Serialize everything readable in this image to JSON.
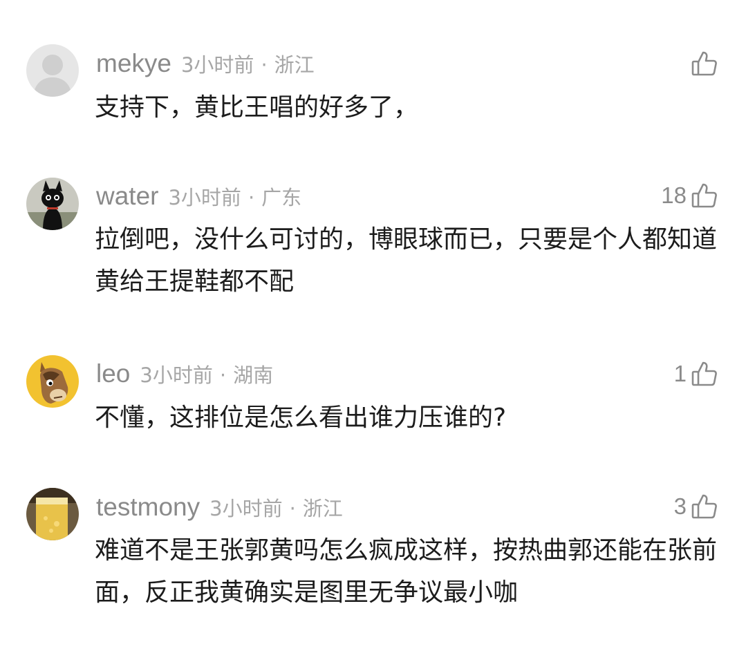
{
  "comments": [
    {
      "username": "mekye",
      "time": "3小时前",
      "separator": "·",
      "location": "浙江",
      "like_count": "",
      "text": "支持下，黄比王唱的好多了，"
    },
    {
      "username": "water",
      "time": "3小时前",
      "separator": "·",
      "location": "广东",
      "like_count": "18",
      "text": "拉倒吧，没什么可讨的，博眼球而已，只要是个人都知道黄给王提鞋都不配"
    },
    {
      "username": "leo",
      "time": "3小时前",
      "separator": "·",
      "location": "湖南",
      "like_count": "1",
      "text": "不懂，这排位是怎么看出谁力压谁的?"
    },
    {
      "username": "testmony",
      "time": "3小时前",
      "separator": "·",
      "location": "浙江",
      "like_count": "3",
      "text": "难道不是王张郭黄吗怎么疯成这样，按热曲郭还能在张前面，反正我黄确实是图里无争议最小咖"
    }
  ],
  "icons": {
    "like": "thumbs-up-icon",
    "avatar_default": "default-avatar-icon"
  },
  "colors": {
    "username": "#8a8a8a",
    "meta": "#a6a6a6",
    "text": "#1c1c1c",
    "icon": "#8a8a8a"
  }
}
